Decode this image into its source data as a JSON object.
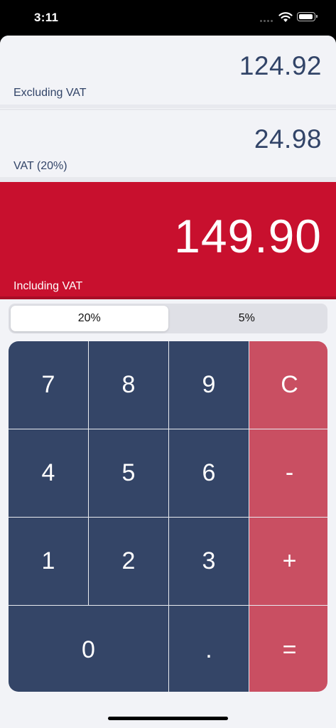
{
  "status_bar": {
    "time": "3:11"
  },
  "excluding": {
    "value": "124.92",
    "label": "Excluding VAT"
  },
  "vat": {
    "value": "24.98",
    "label": "VAT (20%)"
  },
  "including": {
    "value": "149.90",
    "label": "Including VAT"
  },
  "rate_selector": {
    "options": [
      "20%",
      "5%"
    ],
    "selected": "20%"
  },
  "keypad": {
    "keys": [
      "7",
      "8",
      "9",
      "C",
      "4",
      "5",
      "6",
      "-",
      "1",
      "2",
      "3",
      "+",
      "0",
      ".",
      "="
    ]
  },
  "colors": {
    "accent_red": "#c8102e",
    "keypad_navy": "#344567",
    "operator_red": "#c94f62",
    "text_navy": "#324468"
  }
}
